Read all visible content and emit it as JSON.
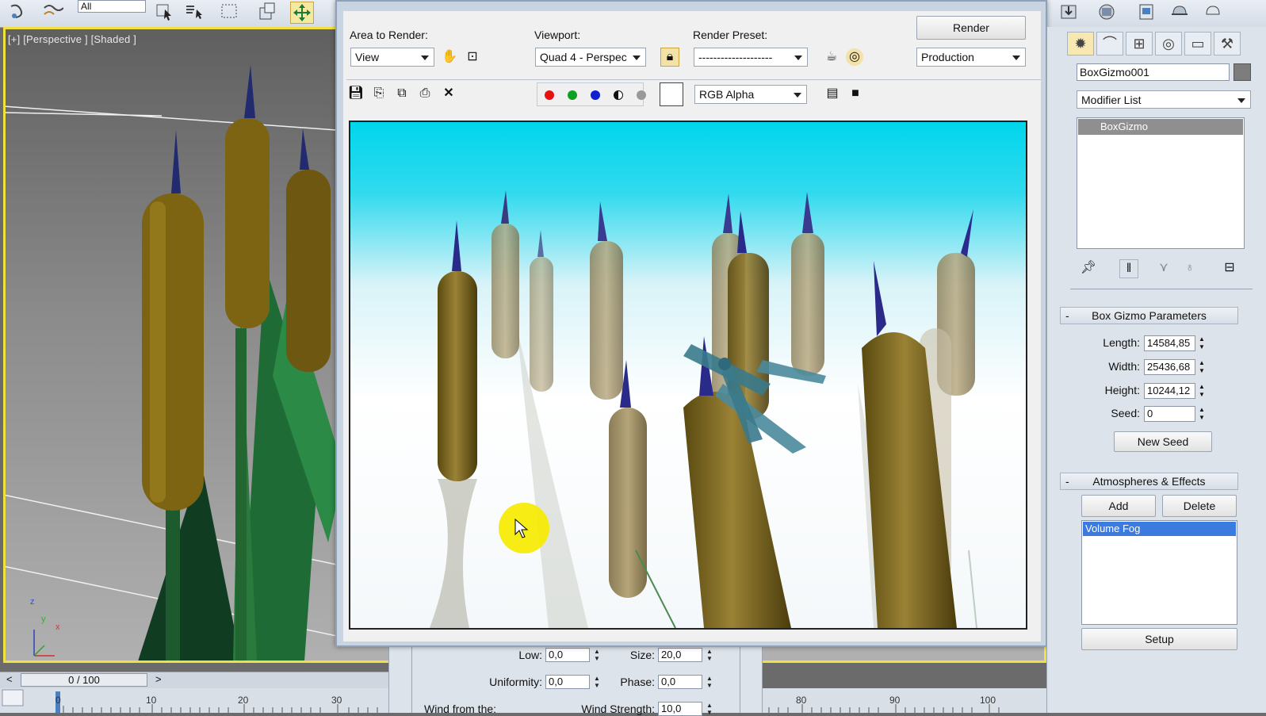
{
  "toolbar": {
    "selection_filter": "All",
    "icons": [
      "select-and-link-icon",
      "bind-space-warp-icon",
      "select-object-icon",
      "select-by-name-icon",
      "rectangular-selection-icon",
      "window-crossing-icon",
      "move-icon",
      "schematic-icon",
      "render-setup-icon",
      "rendered-frame-icon",
      "render-production-icon"
    ]
  },
  "viewport": {
    "label": "[+] [Perspective ] [Shaded ]",
    "axis_labels": {
      "z": "z",
      "y": "y",
      "x": "x"
    }
  },
  "timeline": {
    "frame_display": "0 / 100",
    "prev": "<",
    "next": ">",
    "ticks_left": [
      "0",
      "10",
      "20",
      "30"
    ],
    "ticks_right": [
      "80",
      "90",
      "100"
    ]
  },
  "fog_panel": {
    "low_label": "Low:",
    "low_value": "0,0",
    "size_label": "Size:",
    "size_value": "20,0",
    "uniformity_label": "Uniformity:",
    "uniformity_value": "0,0",
    "phase_label": "Phase:",
    "phase_value": "0,0",
    "wind_from_label": "Wind from the:",
    "wind_strength_label": "Wind Strength:",
    "wind_strength_value": "10,0"
  },
  "render_window": {
    "area_label": "Area to Render:",
    "area_value": "View",
    "viewport_label": "Viewport:",
    "viewport_value": "Quad 4 - Perspec",
    "preset_label": "Render Preset:",
    "preset_value": "--------------------",
    "render_button": "Render",
    "mode_value": "Production",
    "channel_value": "RGB Alpha",
    "channels": {
      "red": "#e81010",
      "green": "#10a020",
      "blue": "#1020d0"
    }
  },
  "command_panel": {
    "object_name": "BoxGizmo001",
    "modifier_list": "Modifier List",
    "stack_item": "BoxGizmo",
    "box_gizmo_title": "Box Gizmo Parameters",
    "length_label": "Length:",
    "length_value": "14584,85",
    "width_label": "Width:",
    "width_value": "25436,68",
    "height_label": "Height:",
    "height_value": "10244,12",
    "seed_label": "Seed:",
    "seed_value": "0",
    "new_seed_button": "New Seed",
    "atmospheres_title": "Atmospheres & Effects",
    "add_button": "Add",
    "delete_button": "Delete",
    "effects_list": [
      "Volume Fog"
    ],
    "setup_button": "Setup",
    "collapse_symbol": "-"
  },
  "colors": {
    "viewport_border": "#f0e040",
    "sky": "#00d6ec",
    "selection": "#3b7be0",
    "cursor_highlight": "#f6ea00"
  }
}
